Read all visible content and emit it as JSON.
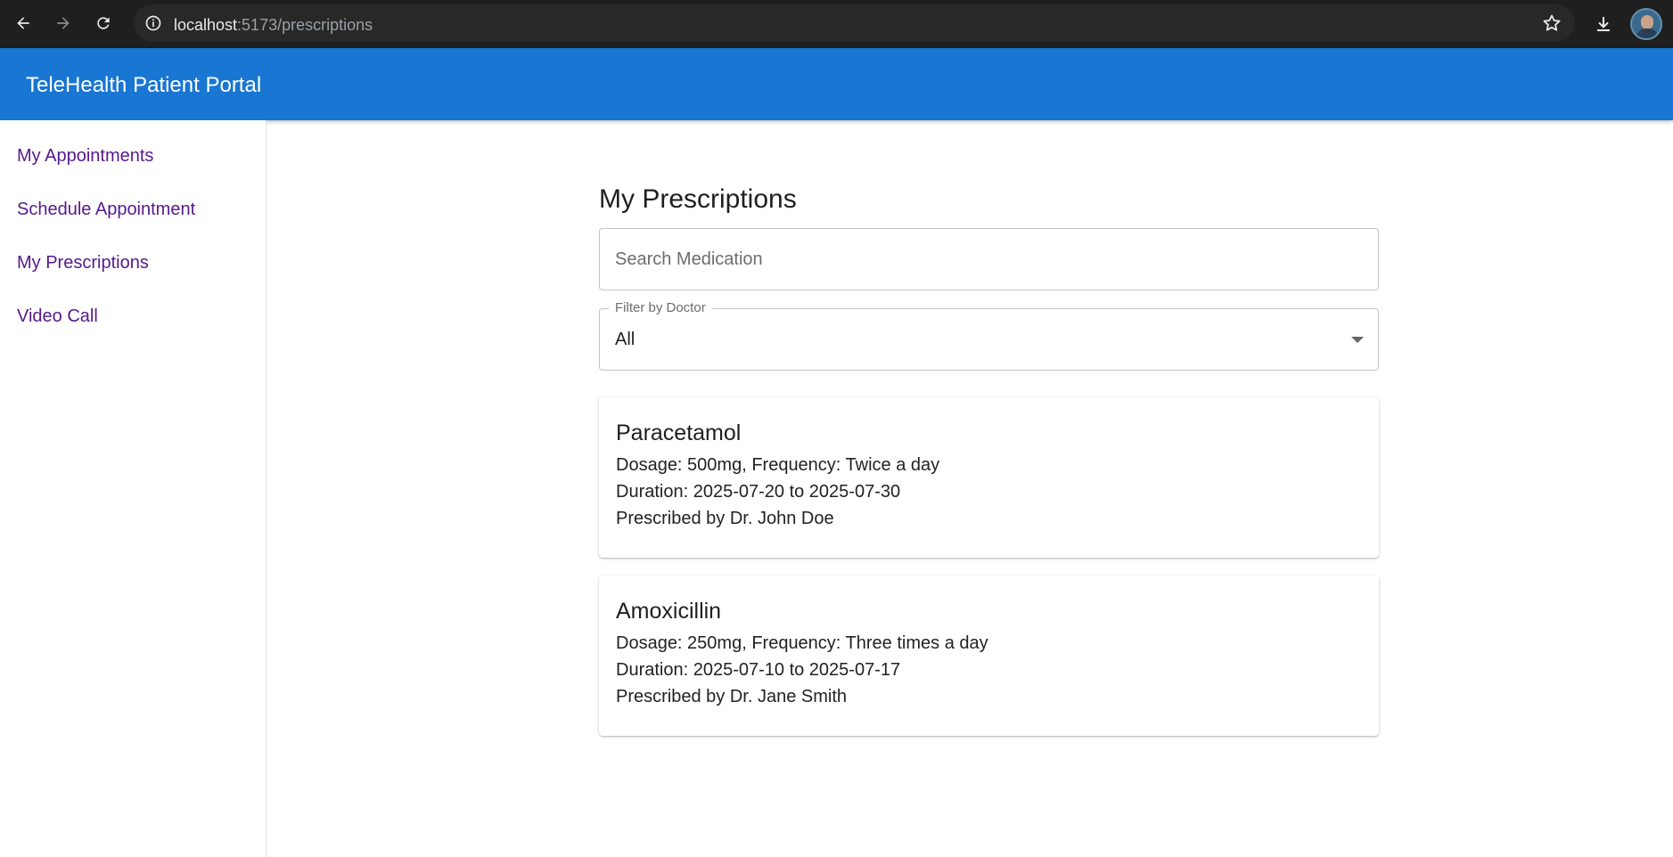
{
  "browser": {
    "url_host": "localhost",
    "url_path": ":5173/prescriptions"
  },
  "app": {
    "title": "TeleHealth Patient Portal"
  },
  "sidebar": {
    "items": [
      {
        "label": "My Appointments"
      },
      {
        "label": "Schedule Appointment"
      },
      {
        "label": "My Prescriptions"
      },
      {
        "label": "Video Call"
      }
    ]
  },
  "main": {
    "title": "My Prescriptions",
    "search": {
      "placeholder": "Search Medication",
      "value": ""
    },
    "filter": {
      "label": "Filter by Doctor",
      "value": "All"
    }
  },
  "prescriptions": [
    {
      "name": "Paracetamol",
      "dosage_line": "Dosage: 500mg, Frequency: Twice a day",
      "duration_line": "Duration: 2025-07-20 to 2025-07-30",
      "doctor_line": "Prescribed by Dr. John Doe"
    },
    {
      "name": "Amoxicillin",
      "dosage_line": "Dosage: 250mg, Frequency: Three times a day",
      "duration_line": "Duration: 2025-07-10 to 2025-07-17",
      "doctor_line": "Prescribed by Dr. Jane Smith"
    }
  ],
  "colors": {
    "appbar": "#1976d2",
    "link": "#551a8b",
    "chrome": "#1f1f1f"
  },
  "icons": {
    "back": "arrow-left-icon",
    "forward": "arrow-right-icon",
    "reload": "reload-icon",
    "info": "info-icon",
    "star": "star-icon",
    "download": "download-icon",
    "profile": "avatar"
  }
}
